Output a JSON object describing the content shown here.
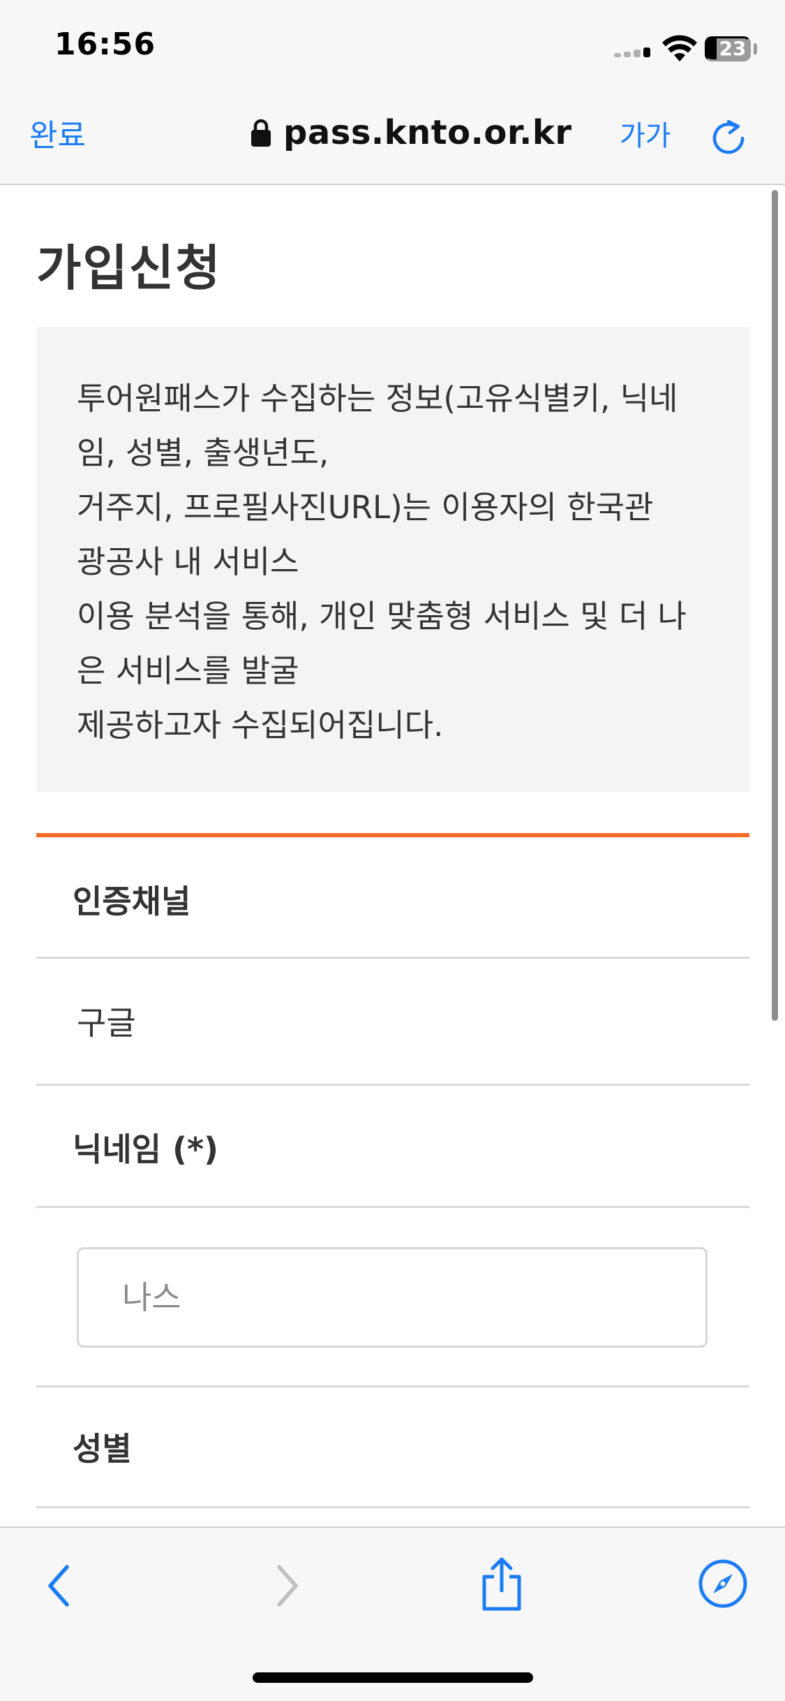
{
  "status_bar": {
    "time": "16:56",
    "battery": "23",
    "icons": [
      "cellular-signal-icon",
      "wifi-icon",
      "battery-icon"
    ]
  },
  "browser": {
    "done_label": "완료",
    "url": "pass.knto.or.kr",
    "text_size_label": "가가",
    "icons": [
      "lock-icon",
      "reload-icon"
    ]
  },
  "page": {
    "title": "가입신청",
    "notice_lines": [
      "투어원패스가 수집하는 정보(고유식별키, 닉네",
      "임, 성별, 출생년도,",
      "거주지, 프로필사진URL)는 이용자의 한국관",
      "광공사 내 서비스",
      "이용 분석을 통해, 개인 맞춤형 서비스 및 더 나",
      "은 서비스를 발굴",
      "제공하고자 수집되어집니다."
    ],
    "auth_channel_label": "인증채널",
    "auth_channel_value": "구글",
    "nickname_label": "닉네임 (*)",
    "nickname_placeholder": "나스",
    "gender_label": "성별"
  },
  "toolbar": {
    "icons": [
      "back-icon",
      "forward-icon",
      "share-icon",
      "compass-icon"
    ]
  },
  "colors": {
    "accent": "#1b7cf4",
    "orange_rule": "#f26c23",
    "notice_bg": "#f4f4f4"
  }
}
